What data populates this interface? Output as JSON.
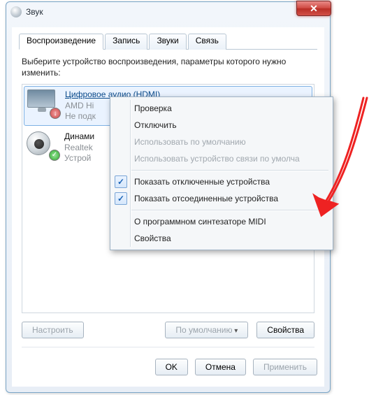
{
  "window": {
    "title": "Звук"
  },
  "tabs": [
    {
      "label": "Воспроизведение",
      "active": true
    },
    {
      "label": "Запись"
    },
    {
      "label": "Звуки"
    },
    {
      "label": "Связь"
    }
  ],
  "instruction": "Выберите устройство воспроизведения, параметры которого нужно изменить:",
  "devices": [
    {
      "title": "Цифровое аудио (HDMI)",
      "line2": "AMD Hi",
      "line3": "Не подк",
      "selected": true,
      "badge": "down",
      "icon": "monitor"
    },
    {
      "title": "Динами",
      "line2": "Realtek",
      "line3": "Устрой",
      "selected": false,
      "badge": "ok",
      "icon": "speaker"
    }
  ],
  "context_menu": {
    "items": [
      {
        "label": "Проверка",
        "enabled": true
      },
      {
        "label": "Отключить",
        "enabled": true
      },
      {
        "label": "Использовать по умолчанию",
        "enabled": false
      },
      {
        "label": "Использовать устройство связи по умолча",
        "enabled": false
      },
      {
        "sep": true
      },
      {
        "label": "Показать отключенные устройства",
        "enabled": true,
        "checked": true
      },
      {
        "label": "Показать отсоединенные устройства",
        "enabled": true,
        "checked": true
      },
      {
        "sep": true
      },
      {
        "label": "О программном синтезаторе MIDI",
        "enabled": true
      },
      {
        "label": "Свойства",
        "enabled": true
      }
    ]
  },
  "buttons": {
    "configure": "Настроить",
    "set_default": "По умолчанию",
    "properties": "Свойства",
    "ok": "OK",
    "cancel": "Отмена",
    "apply": "Применить"
  },
  "close_glyph": "✕"
}
